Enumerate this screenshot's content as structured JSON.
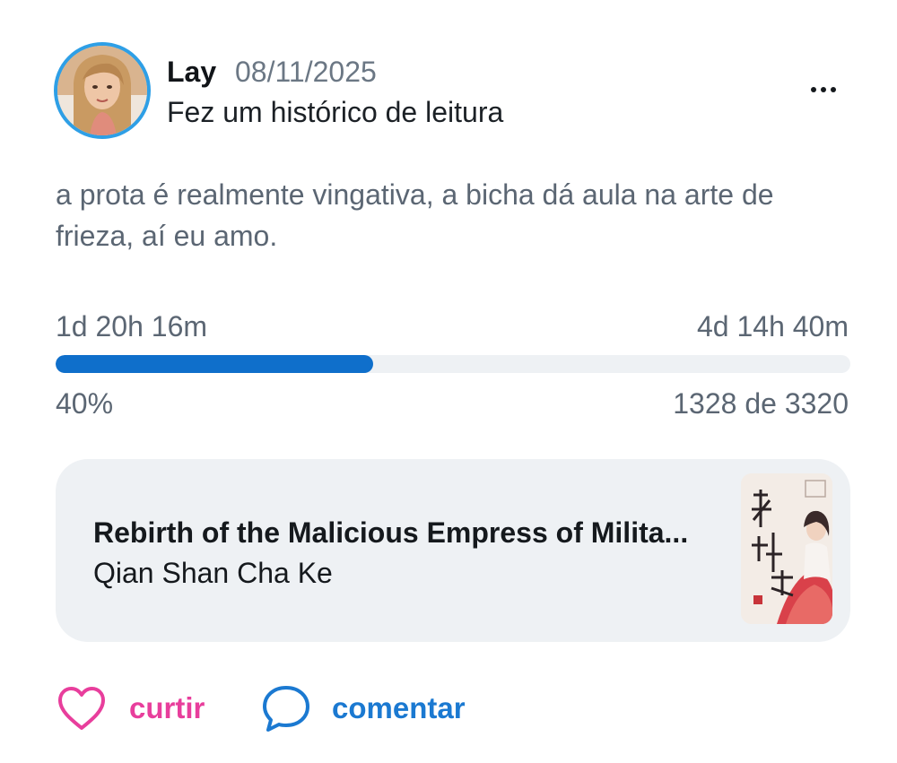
{
  "post": {
    "user_name": "Lay",
    "date": "08/11/2025",
    "action": "Fez um histórico de leitura",
    "body": "a prota é realmente vingativa, a bicha dá aula na arte de frieza, aí eu amo.",
    "more_icon": "more-horizontal-icon"
  },
  "progress": {
    "time_spent": "1d 20h 16m",
    "time_left": "4d 14h 40m",
    "percent_label": "40%",
    "percent_value": 40,
    "pages_label": "1328 de 3320"
  },
  "book": {
    "title": "Rebirth of the Malicious Empress of Milita...",
    "author": "Qian Shan Cha Ke"
  },
  "actions": {
    "like_label": "curtir",
    "like_icon": "heart-icon",
    "like_color": "#e83e9c",
    "comment_label": "comentar",
    "comment_icon": "comment-bubble-icon",
    "comment_color": "#1b79d1"
  },
  "colors": {
    "avatar_ring": "#2e9fe6",
    "progress_fill": "#0f6fcb",
    "progress_track": "#eef1f4",
    "card_background": "#eef1f4"
  }
}
